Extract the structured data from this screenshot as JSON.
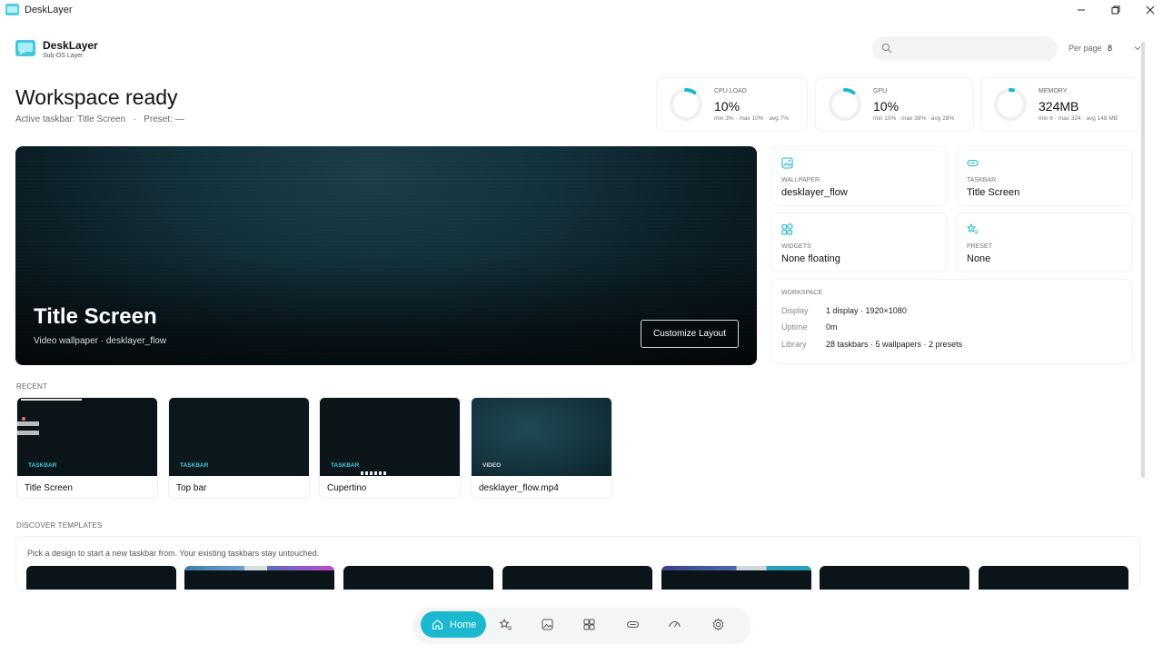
{
  "window": {
    "title": "DeskLayer",
    "minimize_icon": "minimize-icon",
    "maximize_icon": "restore-icon",
    "close_icon": "close-icon"
  },
  "header": {
    "brand_name": "DeskLayer",
    "brand_sub": "Sub-OS Layer",
    "search_placeholder": "",
    "per_page_label": "Per page",
    "per_page_value": "8"
  },
  "page": {
    "headline": "Workspace ready",
    "subline": "Active taskbar: Title Screen   ·   Preset: —"
  },
  "stats": [
    {
      "label": "CPU LOAD",
      "value": "10%",
      "meta": "min 3% · max 10% · avg 7%",
      "fraction": 0.1
    },
    {
      "label": "GPU",
      "value": "10%",
      "meta": "min 10% · max 38% · avg 28%",
      "fraction": 0.1
    },
    {
      "label": "MEMORY",
      "value": "324MB",
      "meta": "min 6 · max 324 · avg 148 MB",
      "fraction": 0.03
    }
  ],
  "hero": {
    "title": "Title Screen",
    "subtitle": "Video wallpaper · desklayer_flow",
    "button": "Customize Layout"
  },
  "info_cards": [
    {
      "label": "WALLPAPER",
      "value": "desklayer_flow",
      "icon": "image-icon"
    },
    {
      "label": "TASKBAR",
      "value": "Title Screen",
      "icon": "taskbar-icon"
    },
    {
      "label": "WIDGETS",
      "value": "None floating",
      "icon": "widgets-icon"
    },
    {
      "label": "PRESET",
      "value": "None",
      "icon": "star-list-icon"
    }
  ],
  "workspace": {
    "title": "WORKSPACE",
    "rows": [
      {
        "k": "Display",
        "v": "1 display · 1920×1080"
      },
      {
        "k": "Uptime",
        "v": "0m"
      },
      {
        "k": "Library",
        "v": "28 taskbars · 5 wallpapers · 2 presets"
      }
    ]
  },
  "recent": {
    "label": "RECENT",
    "items": [
      {
        "tag": "TASKBAR",
        "name": "Title Screen"
      },
      {
        "tag": "TASKBAR",
        "name": "Top bar"
      },
      {
        "tag": "TASKBAR",
        "name": "Cupertino"
      },
      {
        "tag": "VIDEO",
        "name": "desklayer_flow.mp4"
      }
    ]
  },
  "discover": {
    "label": "DISCOVER TEMPLATES",
    "text": "Pick a design to start a new taskbar from. Your existing taskbars stay untouched."
  },
  "nav": {
    "home_label": "Home",
    "items": [
      "presets-icon",
      "wallpapers-icon",
      "widgets-icon",
      "taskbars-icon",
      "performance-icon",
      "settings-icon"
    ]
  },
  "colors": {
    "accent": "#1cb8cf",
    "ring_track": "#eef0f2",
    "hero_dark": "#0a1c24"
  }
}
